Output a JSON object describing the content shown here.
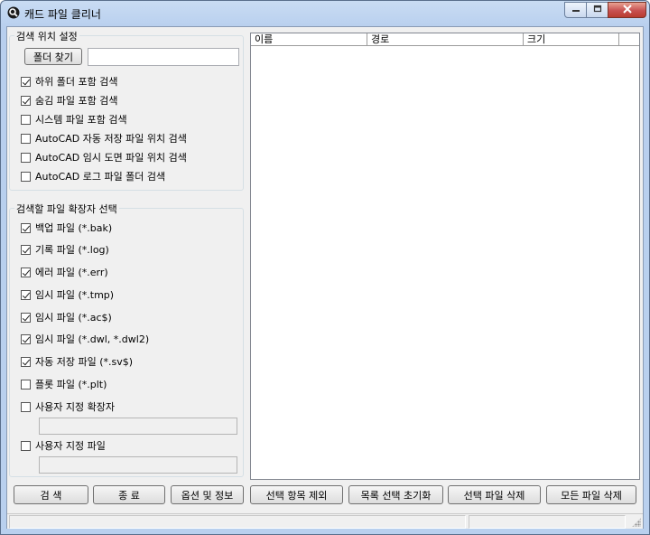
{
  "window": {
    "title": "캐드 파일 클리너"
  },
  "search_location": {
    "group_title": "검색 위치 설정",
    "find_folder_button": "폴더 찾기",
    "folder_path_value": "",
    "options": [
      {
        "label": "하위 폴더 포함 검색",
        "checked": true
      },
      {
        "label": "숨김 파일 포함 검색",
        "checked": true
      },
      {
        "label": "시스템 파일 포함 검색",
        "checked": false
      },
      {
        "label": "AutoCAD 자동 저장 파일 위치 검색",
        "checked": false
      },
      {
        "label": "AutoCAD 임시 도면 파일 위치 검색",
        "checked": false
      },
      {
        "label": "AutoCAD 로그 파일 폴더 검색",
        "checked": false
      }
    ]
  },
  "extensions": {
    "group_title": "검색할 파일 확장자 선택",
    "options": [
      {
        "label": "백업 파일 (*.bak)",
        "checked": true
      },
      {
        "label": "기록 파일 (*.log)",
        "checked": true
      },
      {
        "label": "에러 파일 (*.err)",
        "checked": true
      },
      {
        "label": "임시 파일 (*.tmp)",
        "checked": true
      },
      {
        "label": "임시 파일 (*.ac$)",
        "checked": true
      },
      {
        "label": "임시 파일 (*.dwl, *.dwl2)",
        "checked": true
      },
      {
        "label": "자동 저장 파일 (*.sv$)",
        "checked": true
      },
      {
        "label": "플롯 파일 (*.plt)",
        "checked": false
      },
      {
        "label": "사용자 지정 확장자",
        "checked": false
      },
      {
        "label": "사용자 지정 파일",
        "checked": false
      }
    ],
    "custom_extension_value": "",
    "custom_file_value": ""
  },
  "file_list": {
    "columns": [
      "이름",
      "경로",
      "크기"
    ],
    "rows": []
  },
  "buttons": {
    "search": "검 색",
    "exit": "종 료",
    "options_info": "옵션 및 정보",
    "exclude_selected": "선택 항목 제외",
    "reset_selection": "목록 선택 초기화",
    "delete_selected": "선택 파일 삭제",
    "delete_all": "모든 파일 삭제"
  },
  "status": {
    "pane1": "",
    "pane2": ""
  },
  "colors": {
    "title_bar": "#b9d0ee",
    "close_button": "#c75050",
    "client_bg": "#f0f0f0"
  }
}
